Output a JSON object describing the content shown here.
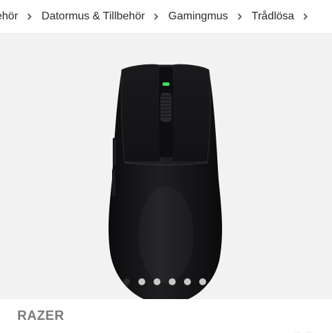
{
  "breadcrumb": {
    "items": [
      {
        "label": "ehör"
      },
      {
        "label": "Datormus & Tillbehör"
      },
      {
        "label": "Gamingmus"
      },
      {
        "label": "Trådlösa"
      }
    ],
    "separator_icon": "chevron-right-icon"
  },
  "gallery": {
    "image_count": 6,
    "active_index": 0,
    "favorite_icon": "heart-outline-icon"
  },
  "product": {
    "brand": "RAZER"
  },
  "colors": {
    "gallery_bg": "#f2f2f2",
    "dot_active": "#2a2a2a",
    "dot_inactive": "#c7c7c7",
    "brand_text": "#7a7a7a",
    "scroll_led": "#3ddc5a"
  }
}
